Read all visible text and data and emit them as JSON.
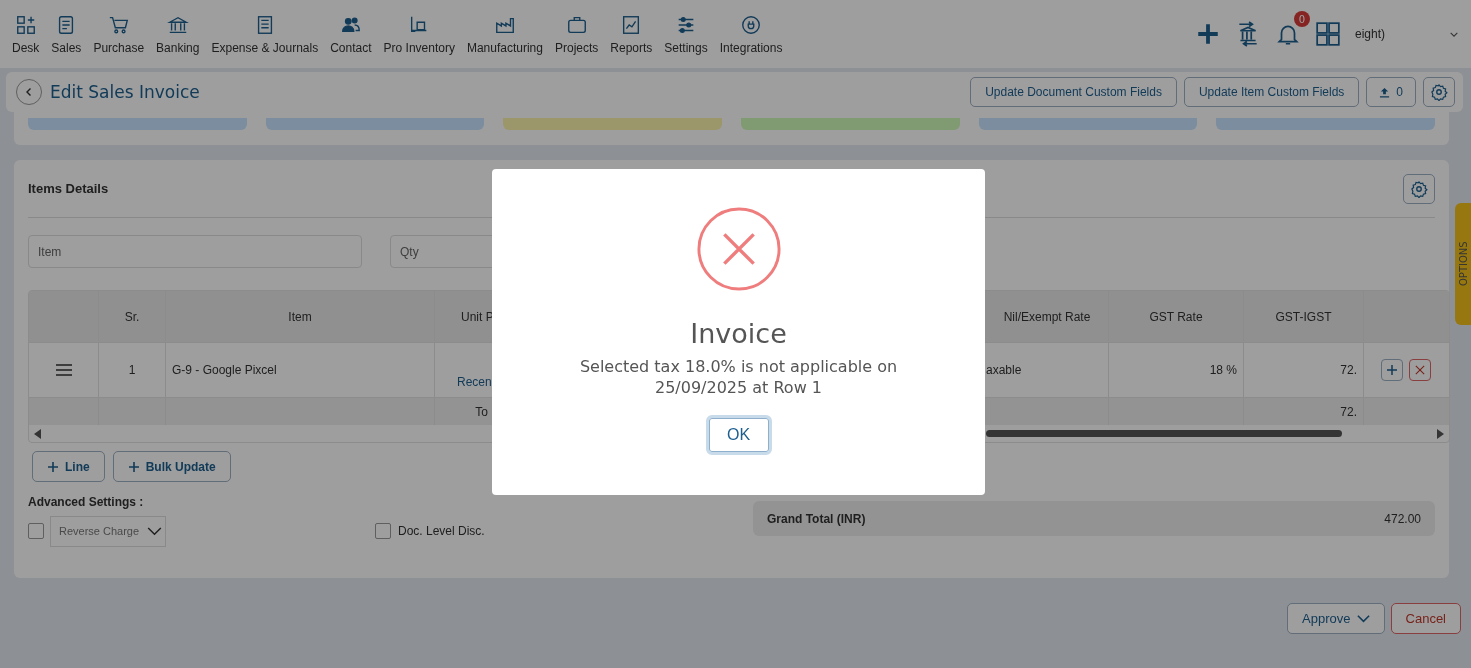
{
  "nav": {
    "items": [
      {
        "label": "Desk"
      },
      {
        "label": "Sales"
      },
      {
        "label": "Purchase"
      },
      {
        "label": "Banking"
      },
      {
        "label": "Expense & Journals"
      },
      {
        "label": "Contact"
      },
      {
        "label": "Pro Inventory"
      },
      {
        "label": "Manufacturing"
      },
      {
        "label": "Projects"
      },
      {
        "label": "Reports"
      },
      {
        "label": "Settings"
      },
      {
        "label": "Integrations"
      }
    ],
    "notification_count": "0",
    "user": "eight)"
  },
  "header": {
    "title": "Edit Sales Invoice",
    "buttons": [
      "Update Document Custom Fields",
      "Update Item Custom Fields"
    ],
    "upload_count": "0"
  },
  "summary_cards": [
    {
      "color": "#7b8d9e"
    },
    {
      "color": "#7b8d9e"
    },
    {
      "color": "#9c976a"
    },
    {
      "color": "#809a72"
    },
    {
      "color": "#7b8d9e"
    },
    {
      "color": "#7b8d9e"
    }
  ],
  "items_details": {
    "title": "Items Details",
    "fields": [
      {
        "placeholder": "Item"
      },
      {
        "placeholder": "Qty"
      }
    ],
    "table": {
      "columns": [
        "Sr.",
        "Item",
        "Unit P",
        "Nil/Exempt Rate",
        "GST Rate",
        "GST-IGST"
      ],
      "rows": [
        {
          "sr": "1",
          "item": "G-9 - Google Pixcel",
          "unit_price_link": "Recen",
          "nil_exempt": "axable",
          "gst_rate": "18 %",
          "gst_igst": "72."
        }
      ],
      "total": {
        "label": "To",
        "gst_igst": "72."
      }
    },
    "buttons": [
      "Line",
      "Bulk Update"
    ],
    "advanced_title": "Advanced Settings :",
    "reverse_charge": {
      "checked": false,
      "label": "Reverse Charge"
    },
    "doc_level_disc": {
      "checked": false,
      "label": "Doc. Level Disc."
    },
    "grand_total": {
      "label": "Grand Total (INR)",
      "value": "472.00"
    }
  },
  "options_tab": "OPTIONS",
  "footer": {
    "approve": "Approve",
    "cancel": "Cancel"
  },
  "dialog": {
    "title": "Invoice",
    "message": "Selected tax 18.0% is not applicable on 25/09/2025 at Row 1",
    "button": "OK"
  }
}
